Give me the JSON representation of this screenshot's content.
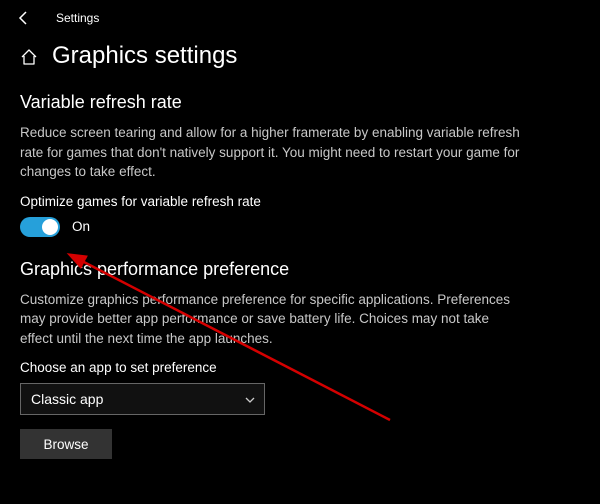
{
  "header": {
    "app_title": "Settings"
  },
  "page": {
    "title": "Graphics settings"
  },
  "vrr": {
    "heading": "Variable refresh rate",
    "description": "Reduce screen tearing and allow for a higher framerate by enabling variable refresh rate for games that don't natively support it. You might need to restart your game for changes to take effect.",
    "option_label": "Optimize games for variable refresh rate",
    "state": "On"
  },
  "perf": {
    "heading": "Graphics performance preference",
    "description": "Customize graphics performance preference for specific applications. Preferences may provide better app performance or save battery life. Choices may not take effect until the next time the app launches.",
    "choose_label": "Choose an app to set preference",
    "selected": "Classic app",
    "browse_label": "Browse"
  }
}
